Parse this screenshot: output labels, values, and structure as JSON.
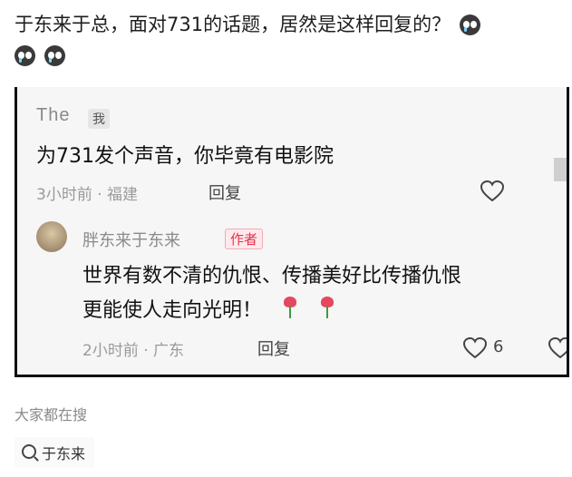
{
  "post": {
    "title": "于东来于总，面对731的话题，居然是这样回复的？"
  },
  "comment": {
    "author": "The",
    "me_tag": "我",
    "text": "为731发个声音，你毕竟有电影院",
    "meta": "3小时前 · 福建",
    "reply_label": "回复"
  },
  "reply": {
    "author": "胖东来于东来",
    "author_tag": "作者",
    "text_line1": "世界有数不清的仇恨、传播美好比传播仇恨",
    "text_line2": "更能使人走向光明！",
    "meta": "2小时前 · 广东",
    "reply_label": "回复",
    "likes": "6"
  },
  "search": {
    "heading": "大家都在搜",
    "query": "于东来"
  },
  "icons": {
    "emoji": "crying-face-icon",
    "heart": "heart-icon",
    "rose": "rose-icon",
    "search": "search-icon"
  },
  "colors": {
    "author_tag": "#e0344d",
    "heart_outline": "#444444"
  }
}
